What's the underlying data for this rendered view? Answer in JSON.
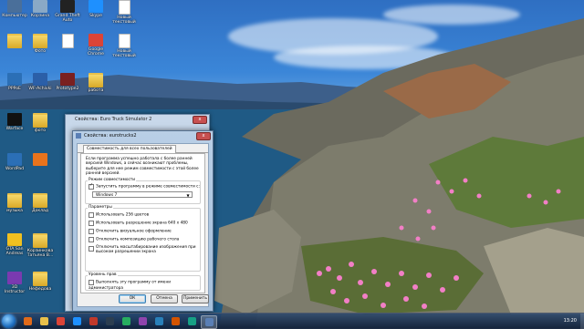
{
  "desktop": {
    "icons": [
      {
        "label": "Компьютер",
        "kind": "app",
        "color": "#4a6f9a"
      },
      {
        "label": "Корзина",
        "kind": "app",
        "color": "#8aa9c6"
      },
      {
        "label": "Grand Theft Auto",
        "kind": "app",
        "color": "#222222"
      },
      {
        "label": "Skype",
        "kind": "app",
        "color": "#1e90ff"
      },
      {
        "label": "Новый текстовый",
        "kind": "doc",
        "color": "#ffffff"
      },
      {
        "label": "",
        "kind": "folder",
        "color": "#e8c04a"
      },
      {
        "label": "Фото",
        "kind": "folder",
        "color": "#e8c04a"
      },
      {
        "label": "",
        "kind": "doc",
        "color": "#ffffff"
      },
      {
        "label": "Google Chrome",
        "kind": "app",
        "color": "#db4437"
      },
      {
        "label": "Новый текстовый",
        "kind": "doc",
        "color": "#ffffff"
      },
      {
        "label": "PPPoE",
        "kind": "app",
        "color": "#2b6fb6"
      },
      {
        "label": "WF-Achivki",
        "kind": "app",
        "color": "#2b5fa8"
      },
      {
        "label": "Prototype2",
        "kind": "app",
        "color": "#7a2020"
      },
      {
        "label": "работа",
        "kind": "folder",
        "color": "#e8c04a"
      },
      {
        "label": "Warface",
        "kind": "app",
        "color": "#111111"
      },
      {
        "label": "фото",
        "kind": "folder",
        "color": "#e8c04a"
      },
      {
        "label": "WordPad",
        "kind": "app",
        "color": "#2b6fb6"
      },
      {
        "label": "",
        "kind": "app",
        "color": "#e8731c"
      },
      {
        "label": "музыка",
        "kind": "folder",
        "color": "#e8c04a"
      },
      {
        "label": "Доклад",
        "kind": "folder",
        "color": "#e8c04a"
      },
      {
        "label": "GTA San Andreas",
        "kind": "app",
        "color": "#f0c020"
      },
      {
        "label": "Корзинкова Татьяна В...",
        "kind": "folder",
        "color": "#e8c04a"
      },
      {
        "label": "3D Instructor",
        "kind": "app",
        "color": "#7a3ab0"
      },
      {
        "label": "Нефедова",
        "kind": "folder",
        "color": "#e8c04a"
      }
    ]
  },
  "back_window": {
    "title": "Свойства: Euro Truck Simulator 2",
    "close": "x"
  },
  "dialog": {
    "title": "Свойства: eurotrucks2",
    "close": "x",
    "tab": "Совместимость для всех пользователей",
    "intro": "Если программа успешно работала с более ранней версией Windows, а сейчас возникают проблемы, выберите для нее режим совместимости с этой более ранней версией.",
    "compat_group": "Режим совместимости",
    "compat_checkbox": "Запустить программу в режиме совместимости с:",
    "compat_checked": true,
    "compat_select": "Windows 7",
    "params_group": "Параметры",
    "params": [
      {
        "label": "Использовать 256 цветов",
        "checked": false
      },
      {
        "label": "Использовать разрешение экрана 640 x 480",
        "checked": false
      },
      {
        "label": "Отключить визуальное оформление",
        "checked": false
      },
      {
        "label": "Отключить композицию рабочего стола",
        "checked": false
      },
      {
        "label": "Отключить масштабирование изображения при высоком разрешении экрана",
        "checked": false
      }
    ],
    "rights_group": "Уровень прав",
    "rights_checkbox": "Выполнять эту программу от имени администратора",
    "rights_checked": false,
    "buttons": {
      "ok": "ОК",
      "cancel": "Отмена",
      "apply": "Применить"
    }
  },
  "taskbar": {
    "items": [
      {
        "icon": "media-player-icon",
        "color": "#e06a1a"
      },
      {
        "icon": "explorer-icon",
        "color": "#e8c04a"
      },
      {
        "icon": "chrome-icon",
        "color": "#db4437"
      },
      {
        "icon": "skype-icon",
        "color": "#1e90ff"
      },
      {
        "icon": "app-icon",
        "color": "#c0392b"
      },
      {
        "icon": "app-icon",
        "color": "#2c3e50"
      },
      {
        "icon": "app-icon",
        "color": "#27ae60"
      },
      {
        "icon": "app-icon",
        "color": "#8e44ad"
      },
      {
        "icon": "app-icon",
        "color": "#2980b9"
      },
      {
        "icon": "app-icon",
        "color": "#d35400"
      },
      {
        "icon": "app-icon",
        "color": "#16a085"
      },
      {
        "icon": "properties-icon",
        "color": "#5a7fb5",
        "active": true
      }
    ],
    "clock": "13:20"
  }
}
